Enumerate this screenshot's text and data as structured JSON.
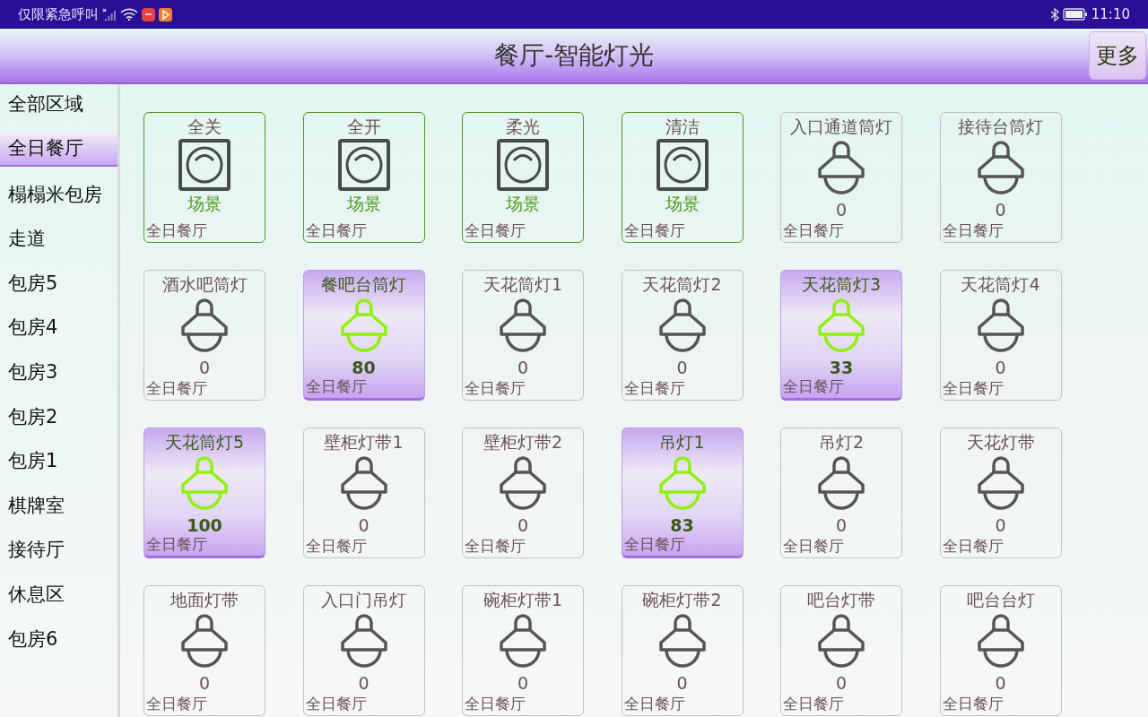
{
  "status_bar": {
    "carrier": "仅限紧急呼叫",
    "time": "11:10"
  },
  "header": {
    "title": "餐厅-智能灯光",
    "more_button": "更多"
  },
  "sidebar": {
    "items": [
      {
        "label": "全部区域",
        "selected": false
      },
      {
        "label": "全日餐厅",
        "selected": true
      },
      {
        "label": "榻榻米包房",
        "selected": false
      },
      {
        "label": "走道",
        "selected": false
      },
      {
        "label": "包房5",
        "selected": false
      },
      {
        "label": "包房4",
        "selected": false
      },
      {
        "label": "包房3",
        "selected": false
      },
      {
        "label": "包房2",
        "selected": false
      },
      {
        "label": "包房1",
        "selected": false
      },
      {
        "label": "棋牌室",
        "selected": false
      },
      {
        "label": "接待厅",
        "selected": false
      },
      {
        "label": "休息区",
        "selected": false
      },
      {
        "label": "包房6",
        "selected": false
      }
    ]
  },
  "devices": [
    {
      "kind": "scene",
      "name": "全关",
      "value": "场景",
      "area": "全日餐厅",
      "on": false
    },
    {
      "kind": "scene",
      "name": "全开",
      "value": "场景",
      "area": "全日餐厅",
      "on": false
    },
    {
      "kind": "scene",
      "name": "柔光",
      "value": "场景",
      "area": "全日餐厅",
      "on": false
    },
    {
      "kind": "scene",
      "name": "清洁",
      "value": "场景",
      "area": "全日餐厅",
      "on": false
    },
    {
      "kind": "light",
      "name": "入口通道筒灯",
      "value": "0",
      "area": "全日餐厅",
      "on": false
    },
    {
      "kind": "light",
      "name": "接待台筒灯",
      "value": "0",
      "area": "全日餐厅",
      "on": false
    },
    {
      "kind": "light",
      "name": "酒水吧筒灯",
      "value": "0",
      "area": "全日餐厅",
      "on": false
    },
    {
      "kind": "light",
      "name": "餐吧台筒灯",
      "value": "80",
      "area": "全日餐厅",
      "on": true
    },
    {
      "kind": "light",
      "name": "天花筒灯1",
      "value": "0",
      "area": "全日餐厅",
      "on": false
    },
    {
      "kind": "light",
      "name": "天花筒灯2",
      "value": "0",
      "area": "全日餐厅",
      "on": false
    },
    {
      "kind": "light",
      "name": "天花筒灯3",
      "value": "33",
      "area": "全日餐厅",
      "on": true
    },
    {
      "kind": "light",
      "name": "天花筒灯4",
      "value": "0",
      "area": "全日餐厅",
      "on": false
    },
    {
      "kind": "light",
      "name": "天花筒灯5",
      "value": "100",
      "area": "全日餐厅",
      "on": true
    },
    {
      "kind": "light",
      "name": "壁柜灯带1",
      "value": "0",
      "area": "全日餐厅",
      "on": false
    },
    {
      "kind": "light",
      "name": "壁柜灯带2",
      "value": "0",
      "area": "全日餐厅",
      "on": false
    },
    {
      "kind": "light",
      "name": "吊灯1",
      "value": "83",
      "area": "全日餐厅",
      "on": true
    },
    {
      "kind": "light",
      "name": "吊灯2",
      "value": "0",
      "area": "全日餐厅",
      "on": false
    },
    {
      "kind": "light",
      "name": "天花灯带",
      "value": "0",
      "area": "全日餐厅",
      "on": false
    },
    {
      "kind": "light",
      "name": "地面灯带",
      "value": "0",
      "area": "全日餐厅",
      "on": false
    },
    {
      "kind": "light",
      "name": "入口门吊灯",
      "value": "0",
      "area": "全日餐厅",
      "on": false
    },
    {
      "kind": "light",
      "name": "碗柜灯带1",
      "value": "0",
      "area": "全日餐厅",
      "on": false
    },
    {
      "kind": "light",
      "name": "碗柜灯带2",
      "value": "0",
      "area": "全日餐厅",
      "on": false
    },
    {
      "kind": "light",
      "name": "吧台灯带",
      "value": "0",
      "area": "全日餐厅",
      "on": false
    },
    {
      "kind": "light",
      "name": "吧台台灯",
      "value": "0",
      "area": "全日餐厅",
      "on": false
    }
  ]
}
